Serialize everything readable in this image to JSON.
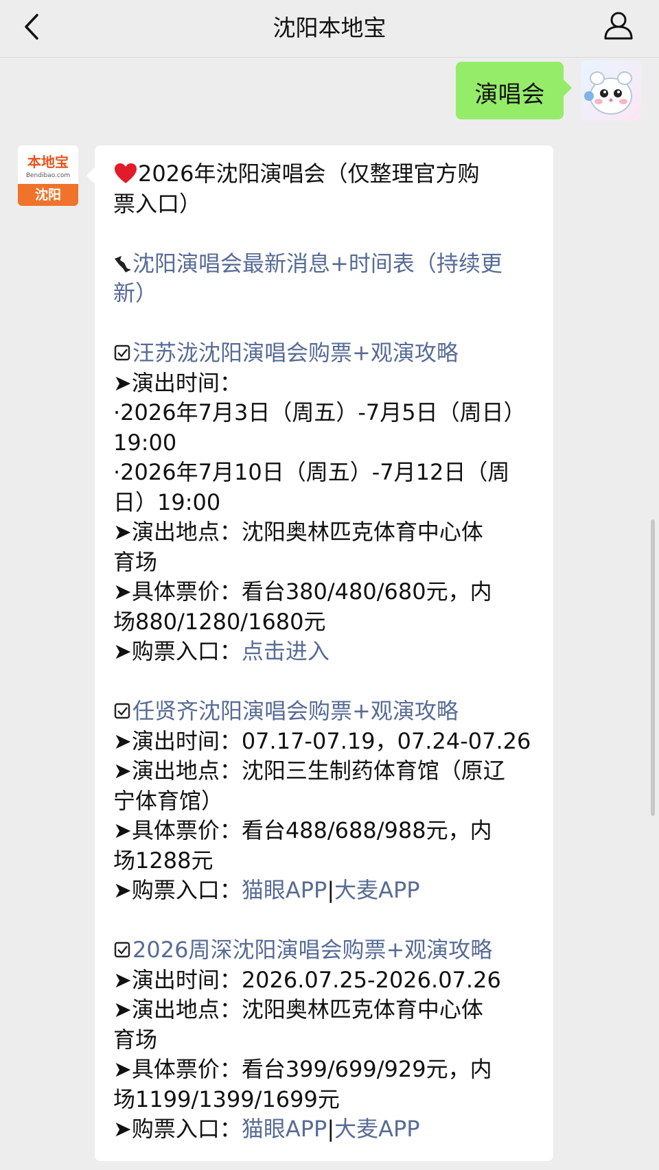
{
  "header": {
    "title": "沈阳本地宝"
  },
  "sent": {
    "text": "演唱会"
  },
  "bot": {
    "brand": "本地宝",
    "domain": "Bendibao.com",
    "city": "沈阳"
  },
  "message": {
    "title_1": "2026年沈阳演唱会（仅整理官方购",
    "title_2": "票入口）",
    "news_1": "沈阳演唱会最新消息+时间表（持续更",
    "news_2": "新）",
    "concerts": [
      {
        "name": "汪苏泷沈阳演唱会购票+观演攻略",
        "time_label": "➤演出时间：",
        "time_1": "·2026年7月3日（周五）-7月5日（周日）",
        "time_2": "19:00",
        "time_3": "·2026年7月10日（周五）-7月12日（周",
        "time_4": "日）19:00",
        "venue_1": "➤演出地点：沈阳奥林匹克体育中心体",
        "venue_2": "育场",
        "price_1": "➤具体票价：看台380/480/680元，内",
        "price_2": "场880/1280/1680元",
        "entry_label": "➤购票入口：",
        "entry_link": "点击进入"
      },
      {
        "name": "任贤齐沈阳演唱会购票+观演攻略",
        "time": "➤演出时间：07.17-07.19，07.24-07.26",
        "venue_1": "➤演出地点：沈阳三生制药体育馆（原辽",
        "venue_2": "宁体育馆）",
        "price_1": "➤具体票价：看台488/688/988元，内",
        "price_2": "场1288元",
        "entry_label": "➤购票入口：",
        "entry_link_1": "猫眼APP",
        "entry_sep": "|",
        "entry_link_2": "大麦APP"
      },
      {
        "name": "2026周深沈阳演唱会购票+观演攻略",
        "time": "➤演出时间：2026.07.25-2026.07.26",
        "venue_1": "➤演出地点：沈阳奥林匹克体育中心体",
        "venue_2": "育场",
        "price_1": "➤具体票价：看台399/699/929元，内",
        "price_2": "场1199/1399/1699元",
        "entry_label": "➤购票入口：",
        "entry_link_1": "猫眼APP",
        "entry_sep": "|",
        "entry_link_2": "大麦APP"
      }
    ]
  },
  "colors": {
    "background": "#ededed",
    "sent_bubble": "#95ec69",
    "link": "#576b95",
    "brand_orange": "#f0722b"
  },
  "icons": [
    "back-arrow-icon",
    "user-profile-icon",
    "heart-icon",
    "pointing-arrow-icon",
    "checkbox-icon"
  ]
}
